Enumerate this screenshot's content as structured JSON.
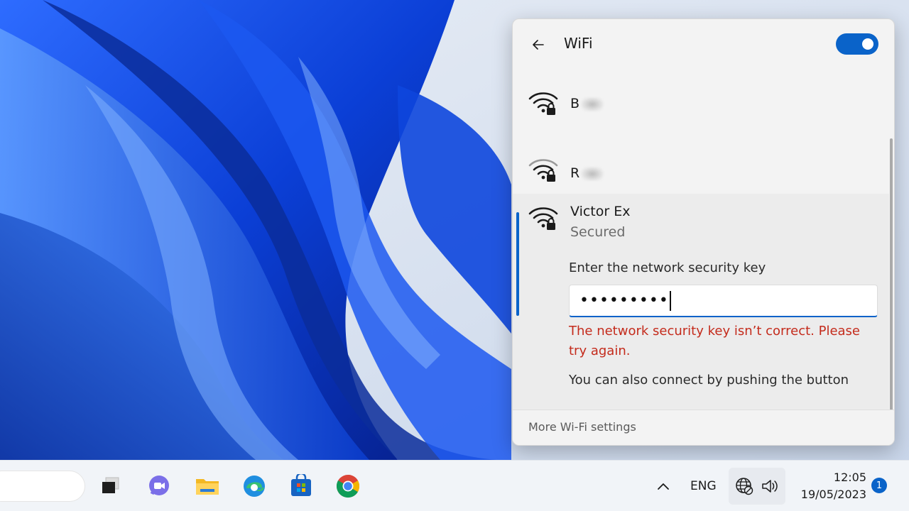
{
  "flyout": {
    "title": "WiFi",
    "toggle_on": true,
    "networks": [
      {
        "name_visible": "B",
        "status": ""
      },
      {
        "name_visible": "R",
        "status": ""
      },
      {
        "name_visible": "Victor Ex",
        "status": "Secured"
      }
    ],
    "selected": {
      "key_label": "Enter the network security key",
      "key_value_masked": "•••••••••",
      "error_text": "The network security key isn’t correct. Please try again.",
      "wps_text": "You can also connect by pushing the button"
    },
    "footer_link": "More Wi-Fi settings"
  },
  "taskbar": {
    "apps": [
      "task-view-icon",
      "teams-chat-icon",
      "file-explorer-icon",
      "edge-icon",
      "microsoft-store-icon",
      "chrome-icon"
    ],
    "tray": {
      "language": "ENG",
      "time": "12:05",
      "date": "19/05/2023",
      "notification_count": "1"
    }
  },
  "colors": {
    "accent": "#0a63c9",
    "error": "#c42b1c"
  }
}
